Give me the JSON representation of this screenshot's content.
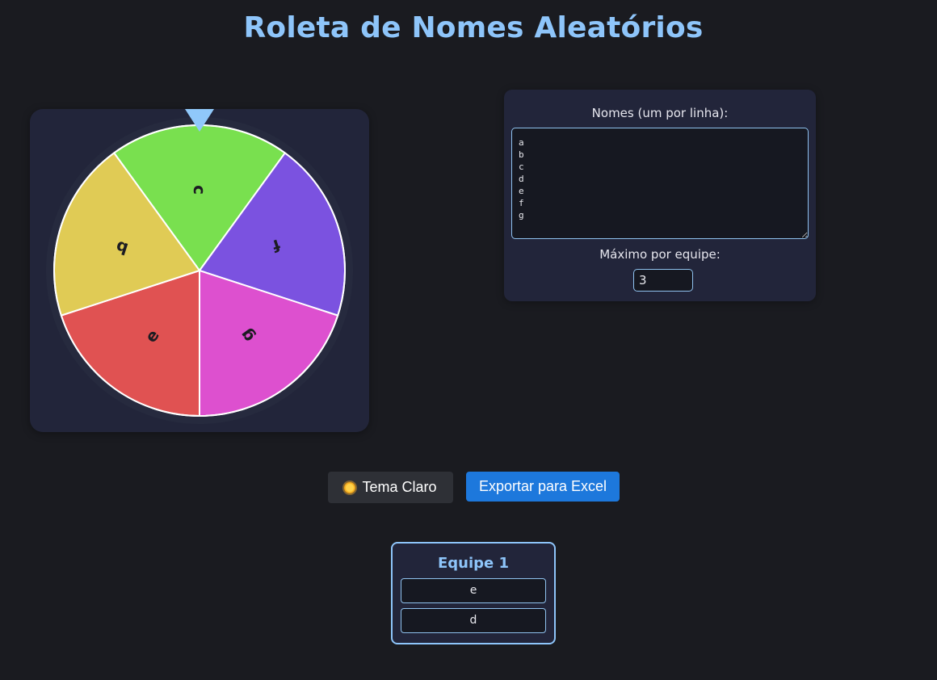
{
  "page": {
    "title": "Roleta de Nomes Aleatórios"
  },
  "wheel": {
    "segments": [
      {
        "label": "c",
        "color": "#79e04f"
      },
      {
        "label": "f",
        "color": "#7b52e0"
      },
      {
        "label": "g",
        "color": "#dd50cf"
      },
      {
        "label": "e",
        "color": "#e05252"
      },
      {
        "label": "q",
        "color": "#e0cb55"
      }
    ]
  },
  "names_panel": {
    "label": "Nomes (um por linha):",
    "names_text": "a\nb\nc\nd\ne\nf\ng",
    "max_label": "Máximo por equipe:",
    "max_value": "3"
  },
  "controls": {
    "theme_button": {
      "label": "Tema Claro",
      "icon": "sun-icon"
    },
    "export_button": {
      "label": "Exportar para Excel"
    }
  },
  "teams": [
    {
      "title": "Equipe 1",
      "members": [
        "e",
        "d"
      ]
    }
  ],
  "colors": {
    "accent": "#8ec5fa",
    "background": "#1a1b20",
    "card": "#22253a",
    "export_button": "#1d78dc"
  }
}
